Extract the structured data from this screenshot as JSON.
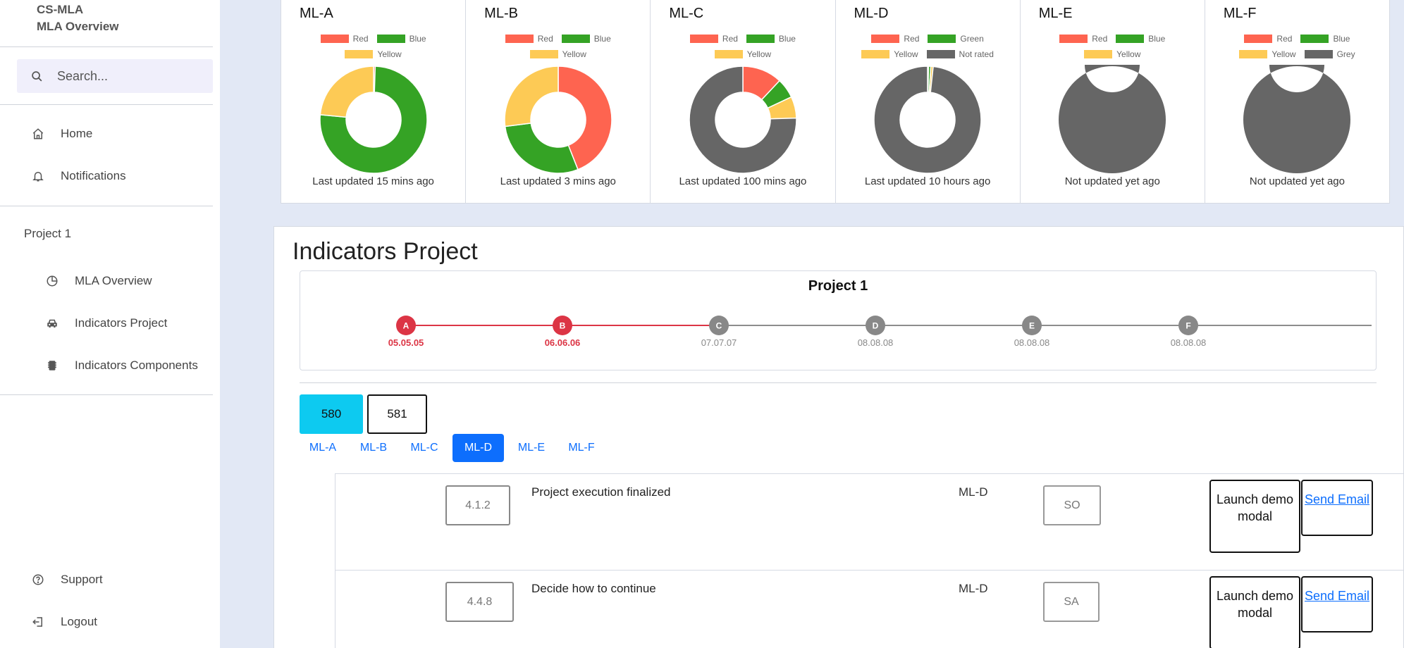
{
  "brand": {
    "line1": "CS-MLA",
    "line2": "MLA Overview"
  },
  "search": {
    "placeholder": "Search..."
  },
  "nav": {
    "home": "Home",
    "notifications": "Notifications",
    "project_label": "Project 1",
    "mla_overview": "MLA Overview",
    "indicators_project": "Indicators Project",
    "indicators_components": "Indicators Components",
    "support": "Support",
    "logout": "Logout"
  },
  "colors": {
    "red": "#fe6450",
    "green": "#35a325",
    "yellow": "#fdca55",
    "grey": "#666666",
    "primary": "#0d6efd",
    "cyan": "#0dcaf0",
    "timeline_red": "#dc3545",
    "timeline_grey": "#888888"
  },
  "chart_data": [
    {
      "type": "pie",
      "title": "ML-A",
      "legend": [
        "Red",
        "Blue",
        "Yellow"
      ],
      "slices": [
        {
          "label": "Red",
          "value": 0.5,
          "color": "#fe6450"
        },
        {
          "label": "Blue",
          "value": 76,
          "color": "#35a325"
        },
        {
          "label": "Yellow",
          "value": 23.5,
          "color": "#fdca55"
        }
      ],
      "caption": "Last updated 15 mins ago"
    },
    {
      "type": "pie",
      "title": "ML-B",
      "legend": [
        "Red",
        "Blue",
        "Yellow"
      ],
      "slices": [
        {
          "label": "Red",
          "value": 44,
          "color": "#fe6450"
        },
        {
          "label": "Blue",
          "value": 29,
          "color": "#35a325"
        },
        {
          "label": "Yellow",
          "value": 27,
          "color": "#fdca55"
        }
      ],
      "caption": "Last updated 3 mins ago"
    },
    {
      "type": "pie",
      "title": "ML-C",
      "legend": [
        "Red",
        "Blue",
        "Yellow"
      ],
      "slices": [
        {
          "label": "Red",
          "value": 12,
          "color": "#fe6450"
        },
        {
          "label": "Blue",
          "value": 6,
          "color": "#35a325"
        },
        {
          "label": "Yellow",
          "value": 6.5,
          "color": "#fdca55"
        },
        {
          "label": "",
          "value": 75.5,
          "color": "#666666"
        }
      ],
      "caption": "Last updated 100 mins ago"
    },
    {
      "type": "pie",
      "title": "ML-D",
      "legend": [
        "Red",
        "Green",
        "Yellow",
        "Not rated"
      ],
      "slices": [
        {
          "label": "Red",
          "value": 0.3,
          "color": "#fe6450"
        },
        {
          "label": "Green",
          "value": 0.7,
          "color": "#35a325"
        },
        {
          "label": "Yellow",
          "value": 0.7,
          "color": "#fdca55"
        },
        {
          "label": "Not rated",
          "value": 98.3,
          "color": "#666666"
        }
      ],
      "caption": "Last updated 10 hours ago"
    },
    {
      "type": "pie",
      "title": "ML-E",
      "legend": [
        "Red",
        "Blue",
        "Yellow"
      ],
      "slices": [
        {
          "label": "",
          "value": 100,
          "color": "#666666"
        }
      ],
      "caption": "Not updated yet ago"
    },
    {
      "type": "pie",
      "title": "ML-F",
      "legend": [
        "Red",
        "Blue",
        "Yellow",
        "Grey"
      ],
      "slices": [
        {
          "label": "Grey",
          "value": 100,
          "color": "#666666"
        }
      ],
      "caption": "Not updated yet ago"
    }
  ],
  "main": {
    "title": "Indicators Project",
    "timeline": {
      "title": "Project 1",
      "milestones": [
        {
          "letter": "A",
          "date": "05.05.05",
          "done": true
        },
        {
          "letter": "B",
          "date": "06.06.06",
          "done": true
        },
        {
          "letter": "C",
          "date": "07.07.07",
          "done": false
        },
        {
          "letter": "D",
          "date": "08.08.08",
          "done": false
        },
        {
          "letter": "E",
          "date": "08.08.08",
          "done": false
        },
        {
          "letter": "F",
          "date": "08.08.08",
          "done": false
        }
      ]
    },
    "numbers": [
      "580",
      "581"
    ],
    "tabs": [
      "ML-A",
      "ML-B",
      "ML-C",
      "ML-D",
      "ML-E",
      "ML-F"
    ],
    "active_tab": "ML-D",
    "rows": [
      {
        "code": "4.1.2",
        "text": "Project execution finalized",
        "ml": "ML-D",
        "tag": "SO",
        "launch": "Launch demo modal",
        "email": "Send Email"
      },
      {
        "code": "4.4.8",
        "text": "Decide how to continue",
        "ml": "ML-D",
        "tag": "SA",
        "launch": "Launch demo modal",
        "email": "Send Email"
      }
    ]
  }
}
